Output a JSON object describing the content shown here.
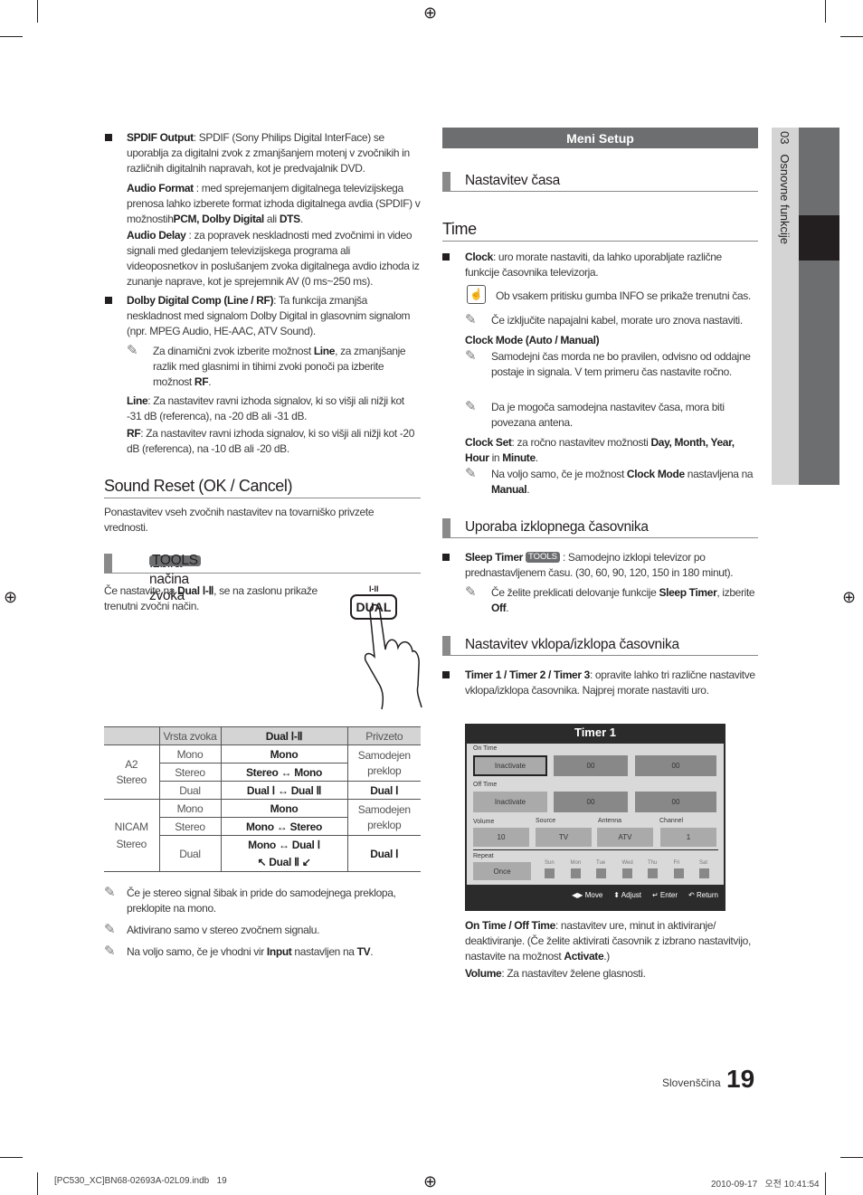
{
  "left": {
    "spdif": [
      {
        "t": "SPDIF Output",
        "b": true
      },
      {
        "t": ": SPDIF (Sony Philips Digital InterFace) se uporablja za digitalni zvok z zmanjšanjem motenj v zvočnikih in različnih digitalnih napravah, kot je predvajalnik DVD."
      }
    ],
    "audio_format": [
      {
        "t": "Audio Format",
        "b": true
      },
      {
        "t": " : med sprejemanjem digitalnega televizijskega prenosa lahko izberete format izhoda digitalnega avdia (SPDIF) v možnostih"
      },
      {
        "t": "PCM, Dolby Digital",
        "b": true
      },
      {
        "t": " ali "
      },
      {
        "t": "DTS",
        "b": true
      },
      {
        "t": "."
      }
    ],
    "audio_delay": [
      {
        "t": "Audio Delay",
        "b": true
      },
      {
        "t": " : za popravek neskladnosti med zvočnimi in video signali med gledanjem televizijskega programa ali videoposnetkov in poslušanjem zvoka digitalnega avdio izhoda iz zunanje naprave, kot je sprejemnik AV (0 ms~250 ms)."
      }
    ],
    "dolby": [
      {
        "t": "Dolby Digital Comp (Line / RF)",
        "b": true
      },
      {
        "t": ": Ta funkcija zmanjša neskladnost med signalom Dolby Digital in glasovnim signalom (npr. MPEG Audio, HE-AAC, ATV Sound)."
      }
    ],
    "dolby_note": [
      {
        "t": "Za dinamični zvok izberite možnost "
      },
      {
        "t": "Line",
        "b": true
      },
      {
        "t": ", za zmanjšanje razlik med glasnimi in tihimi zvoki ponoči pa izberite možnost "
      },
      {
        "t": "RF",
        "b": true
      },
      {
        "t": "."
      }
    ],
    "line": [
      {
        "t": "Line",
        "b": true
      },
      {
        "t": ": Za nastavitev ravni izhoda signalov, ki so višji ali nižji kot -31 dB (referenca), na -20 dB ali -31 dB."
      }
    ],
    "rf": [
      {
        "t": "RF",
        "b": true
      },
      {
        "t": ": Za nastavitev ravni izhoda signalov, ki so višji ali nižji kot -20 dB (referenca), na -10 dB ali -20 dB."
      }
    ],
    "sound_reset_title": "Sound Reset (OK / Cancel)",
    "sound_reset_text": [
      {
        "t": "Ponastavitev vseh zvočnih nastavitev na tovarniško privzete vrednosti."
      }
    ],
    "izbira_title": "Izbira načina zvoka",
    "tools_badge": "TOOLS",
    "izbira_text": [
      {
        "t": "Če nastavite na "
      },
      {
        "t": "Dual Ⅰ-Ⅱ",
        "b": true
      },
      {
        "t": ", se na zaslonu prikaže trenutni zvočni način."
      }
    ],
    "dual_button_top": "I-II",
    "dual_button": "DUAL",
    "table": {
      "headers": [
        "",
        "Vrsta zvoka",
        "Dual Ⅰ-Ⅱ",
        "Privzeto"
      ],
      "a2": "A2\nStereo",
      "nicam": "NICAM\nStereo",
      "rows": [
        [
          "Mono",
          "Mono"
        ],
        [
          "Stereo",
          "Stereo ↔ Mono"
        ],
        [
          "Dual",
          "Dual Ⅰ ↔ Dual Ⅱ"
        ],
        [
          "Mono",
          "Mono"
        ],
        [
          "Stereo",
          "Mono ↔ Stereo"
        ],
        [
          "Dual",
          "Mono ↔ Dual Ⅰ\n↖ Dual Ⅱ ↙"
        ]
      ],
      "auto": "Samodejen\npreklop",
      "dual1": "Dual Ⅰ"
    },
    "notes": [
      [
        {
          "t": "Če je stereo signal šibak in pride do samodejnega preklopa, preklopite na mono."
        }
      ],
      [
        {
          "t": "Aktivirano samo v stereo zvočnem signalu."
        }
      ],
      [
        {
          "t": "Na voljo samo, če je vhodni vir "
        },
        {
          "t": "Input",
          "b": true
        },
        {
          "t": " nastavljen na "
        },
        {
          "t": "TV",
          "b": true
        },
        {
          "t": "."
        }
      ]
    ]
  },
  "right": {
    "menu_bar": "Meni Setup",
    "nastavitev_casa": "Nastavitev časa",
    "time_title": "Time",
    "clock": [
      {
        "t": "Clock",
        "b": true
      },
      {
        "t": ": uro morate nastaviti, da lahko uporabljate različne funkcije časovnika televizorja."
      }
    ],
    "info_note": [
      {
        "t": "Ob vsakem pritisku gumba INFO se prikaže trenutni čas."
      }
    ],
    "power_note": [
      {
        "t": "Če izključite napajalni kabel, morate uro znova nastaviti."
      }
    ],
    "clock_mode": [
      {
        "t": "Clock Mode (Auto / Manual)",
        "b": true
      }
    ],
    "clock_mode_note1": [
      {
        "t": "Samodejni čas morda ne bo pravilen, odvisno od oddajne postaje in signala. V tem primeru čas nastavite ročno."
      }
    ],
    "clock_mode_note2": [
      {
        "t": "Da je mogoča samodejna nastavitev časa, mora biti povezana antena."
      }
    ],
    "clock_set": [
      {
        "t": "Clock Set",
        "b": true
      },
      {
        "t": ": za ročno nastavitev možnosti "
      },
      {
        "t": "Day, Month, Year, Hour",
        "b": true
      },
      {
        "t": " in "
      },
      {
        "t": "Minute",
        "b": true
      },
      {
        "t": "."
      }
    ],
    "clock_set_note": [
      {
        "t": "Na voljo samo, če je možnost "
      },
      {
        "t": "Clock Mode",
        "b": true
      },
      {
        "t": " nastavljena na "
      },
      {
        "t": "Manual",
        "b": true
      },
      {
        "t": "."
      }
    ],
    "uporaba_title": "Uporaba izklopnega časovnika",
    "sleep": [
      {
        "t": "Sleep Timer",
        "b": true
      },
      {
        "t": " [TOOLS] : Samodejno izklopi televizor po prednastavljenem času. (30, 60, 90, 120, 150 in 180 minut)."
      }
    ],
    "sleep_note": [
      {
        "t": "Če želite preklicati delovanje funkcije "
      },
      {
        "t": "Sleep Timer",
        "b": true
      },
      {
        "t": ", izberite "
      },
      {
        "t": "Off",
        "b": true
      },
      {
        "t": "."
      }
    ],
    "vklop_title": "Nastavitev vklopa/izklopa časovnika",
    "timer_text": [
      {
        "t": "Timer 1 / Timer 2 / Timer 3",
        "b": true
      },
      {
        "t": ": opravite lahko tri različne nastavitve vklopa/izklopa časovnika. Najprej morate nastaviti uro."
      }
    ],
    "timer_screen": {
      "title": "Timer 1",
      "on_time": "On Time",
      "off_time": "Off Time",
      "inactivate": "Inactivate",
      "zero": "00",
      "volume": "Volume",
      "source": "Source",
      "antenna": "Antenna",
      "channel": "Channel",
      "volume_val": "10",
      "source_val": "TV",
      "antenna_val": "ATV",
      "channel_val": "1",
      "repeat": "Repeat",
      "repeat_val": "Once",
      "days": [
        "Sun",
        "Mon",
        "Tue",
        "Wed",
        "Thu",
        "Fri",
        "Sat"
      ],
      "move": "Move",
      "adjust": "Adjust",
      "enter": "Enter",
      "return": "Return"
    },
    "on_off_time": [
      {
        "t": "On Time / Off Time",
        "b": true
      },
      {
        "t": ": nastavitev ure, minut in aktiviranje/ deaktiviranje. (Če želite aktivirati časovnik z izbrano nastavitvijo, nastavite na možnost "
      },
      {
        "t": "Activate",
        "b": true
      },
      {
        "t": ".)"
      }
    ],
    "volume_text": [
      {
        "t": "Volume",
        "b": true
      },
      {
        "t": ": Za nastavitev želene glasnosti."
      }
    ]
  },
  "side_tab": {
    "number": "03",
    "label": "Osnovne funkcije"
  },
  "footer": {
    "language": "Slovenščina",
    "page": "19",
    "file": "[PC530_XC]BN68-02693A-02L09.indb   19",
    "date": "2010-09-17   오전 10:41:54"
  },
  "colors": {
    "bar": "#6d6e70",
    "side_light": "#d4d4d4",
    "side_dark": "#231f20"
  }
}
